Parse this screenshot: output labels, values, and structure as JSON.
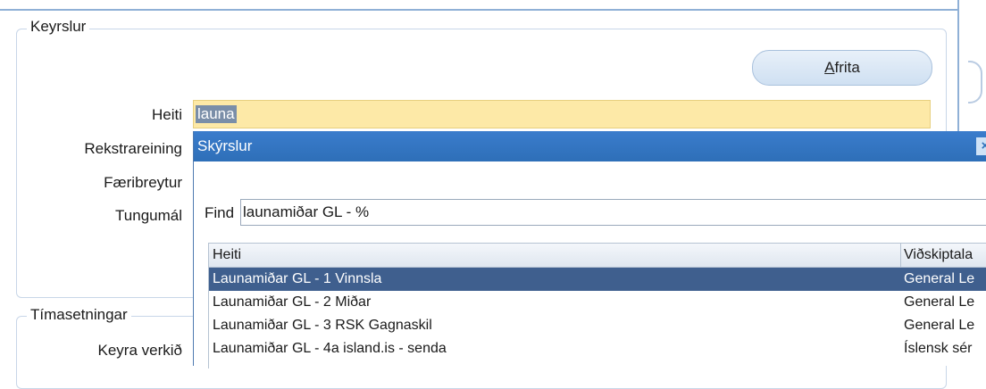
{
  "keyrslur": {
    "legend": "Keyrslur",
    "copy_button": "Afrita",
    "copy_button_mnemonic": "A",
    "copy_button_rest": "frita",
    "labels": {
      "heiti": "Heiti",
      "rekstrareining": "Rekstrareining",
      "faeribreytur": "Færibreytur",
      "tungumal": "Tungumál"
    },
    "heiti_value": "launa"
  },
  "timasetningar": {
    "legend": "Tímasetningar",
    "keyra_label": "Keyra verkið"
  },
  "lov_dialog": {
    "title": "Skýrslur",
    "find_label": "Find",
    "find_value": "launamiðar GL - %",
    "columns": [
      "Heiti",
      "Viðskiptala"
    ],
    "rows": [
      {
        "heiti": "Launamiðar GL - 1 Vinnsla",
        "app": "General Le",
        "selected": true
      },
      {
        "heiti": "Launamiðar GL - 2 Miðar",
        "app": "General Le",
        "selected": false
      },
      {
        "heiti": "Launamiðar GL - 3 RSK Gagnaskil",
        "app": "General Le",
        "selected": false
      },
      {
        "heiti": "Launamiðar GL - 4a island.is - senda",
        "app": "Íslensk sér",
        "selected": false
      }
    ]
  }
}
